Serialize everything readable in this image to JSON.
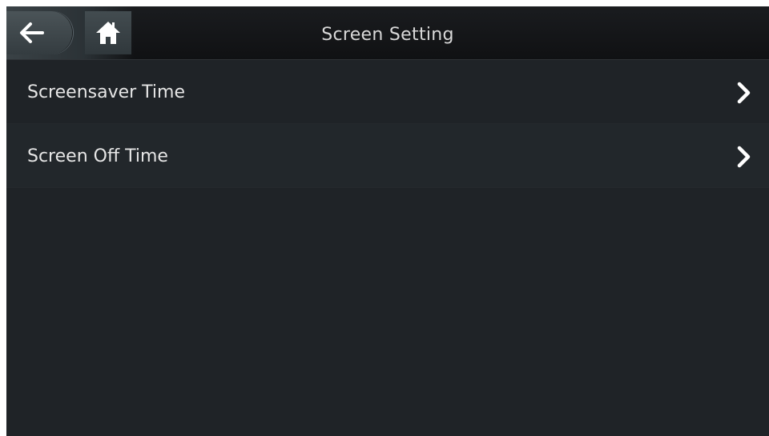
{
  "header": {
    "title": "Screen Setting",
    "back_icon": "arrow-left-icon",
    "home_icon": "home-icon"
  },
  "menu": {
    "items": [
      {
        "label": "Screensaver Time",
        "icon": "chevron-right-icon"
      },
      {
        "label": "Screen Off Time",
        "icon": "chevron-right-icon"
      }
    ]
  },
  "colors": {
    "background": "#1f2327",
    "title_bar": "#121416",
    "text": "#e6e6e6",
    "icon": "#ffffff"
  }
}
